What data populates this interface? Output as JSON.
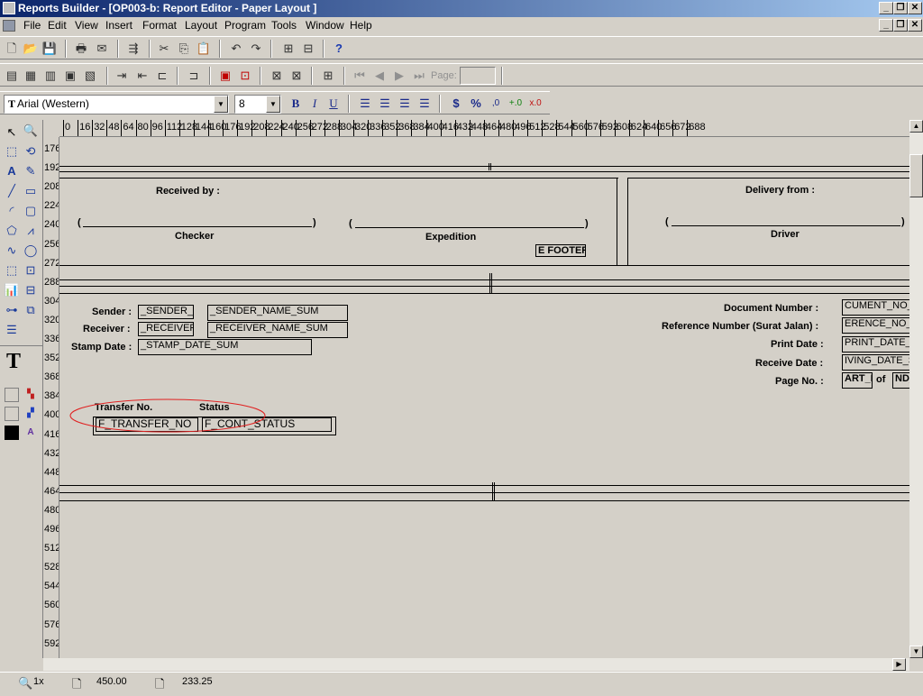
{
  "window": {
    "title": "Reports Builder - [OP003-b: Report Editor - Paper Layout ]",
    "caption_buttons": [
      "_",
      "❐",
      "✕"
    ]
  },
  "menu": [
    "File",
    "Edit",
    "View",
    "Insert",
    "Format",
    "Layout",
    "Program",
    "Tools",
    "Window",
    "Help"
  ],
  "toolbar": {
    "page_label": "Page:",
    "page_value": ""
  },
  "format_bar": {
    "font": "Arial (Western)",
    "font_size": "8",
    "bold": "B",
    "italic": "I",
    "underline": "U",
    "currency": "$",
    "percent": "%",
    "commas": ",0",
    "add_decimal": "+.0",
    "remove_decimal": "x.0"
  },
  "ruler": {
    "horizontal": [
      "0",
      "16",
      "32",
      "48",
      "64",
      "80",
      "96",
      "112",
      "128",
      "144",
      "160",
      "176",
      "192",
      "208",
      "224",
      "240",
      "256",
      "272",
      "288",
      "304",
      "320",
      "336",
      "352",
      "368",
      "384",
      "400",
      "416",
      "432",
      "448",
      "464",
      "480",
      "496",
      "512",
      "528",
      "544",
      "560",
      "576",
      "592",
      "608",
      "624",
      "640",
      "656",
      "672",
      "688"
    ],
    "vertical": [
      "176",
      "192",
      "208",
      "224",
      "240",
      "256",
      "272",
      "288",
      "304",
      "320",
      "336",
      "352",
      "368",
      "384",
      "400",
      "416",
      "432",
      "448",
      "464",
      "480",
      "496",
      "512",
      "528",
      "544",
      "560",
      "576",
      "592"
    ]
  },
  "layout": {
    "received_by": "Received by :",
    "delivery_from": "Delivery from :",
    "open_paren": "(",
    "close_paren": ")",
    "checker": "Checker",
    "expedition": "Expedition",
    "driver": "Driver",
    "footer_field": "F_FOOTER",
    "footer_field_visible": "E FOOTER",
    "sender_label": "Sender :",
    "receiver_label": "Receiver :",
    "stamp_date_label": "Stamp Date :",
    "sender_field": "_SENDER_",
    "receiver_field": "_RECEIVER",
    "sender_name_field": "_SENDER_NAME_SUM",
    "receiver_name_field": "_RECEIVER_NAME_SUM",
    "stamp_date_field": "_STAMP_DATE_SUM",
    "document_number_label": "Document Number  :",
    "reference_number_label": "Reference Number (Surat Jalan)  :",
    "print_date_label": "Print Date  :",
    "receive_date_label": "Receive Date  :",
    "page_no_label": "Page No.  :",
    "document_number_field": "CUMENT_NO_S",
    "reference_number_field": "ERENCE_NO_S",
    "print_date_field": "PRINT_DATE_S",
    "receive_date_field": "IVING_DATE_S",
    "page_start_field": "ART_F",
    "page_of": "of",
    "page_end_field": "ND_",
    "transfer_no_label": "Transfer No.",
    "status_label": "Status",
    "transfer_no_field": "F_TRANSFER_NO",
    "status_field": "F_CONT_STATUS"
  },
  "status_bar": {
    "zoom": "1x",
    "x_pos": "450.00",
    "y_pos": "233.25"
  },
  "colors": {
    "titlebar_start": "#0a246a",
    "titlebar_end": "#a6caf0",
    "annotation_ellipse": "#e02020",
    "face": "#d4d0c8"
  }
}
